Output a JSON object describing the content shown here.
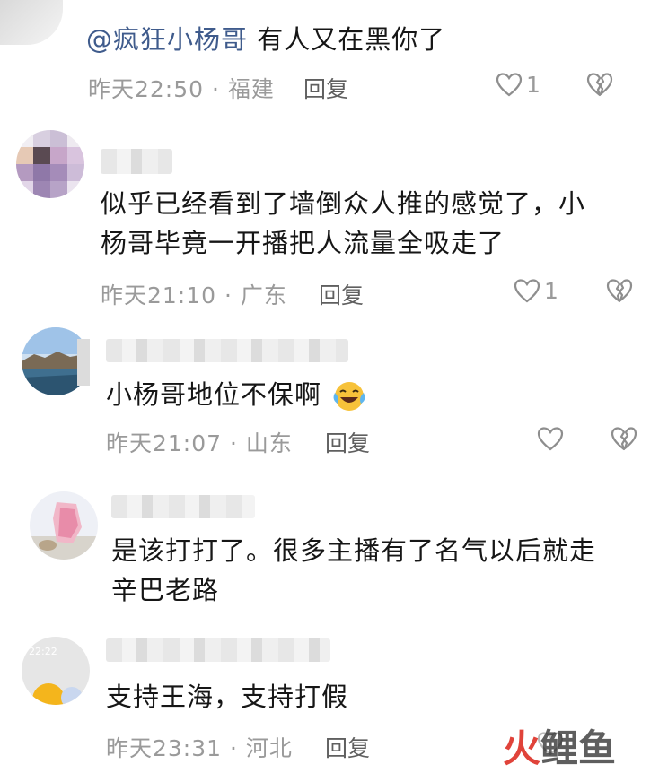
{
  "comments": [
    {
      "mention": "@疯狂小杨哥",
      "text": " 有人又在黑你了",
      "time": "昨天22:50",
      "sep": "·",
      "location": "福建",
      "reply": "回复",
      "likes": "1"
    },
    {
      "text_line1": "似乎已经看到了墙倒众人推的感觉了，小",
      "text_line2": "杨哥毕竟一开播把人流量全吸走了",
      "time": "昨天21:10",
      "sep": "·",
      "location": "广东",
      "reply": "回复",
      "likes": "1"
    },
    {
      "text": "小杨哥地位不保啊",
      "time": "昨天21:07",
      "sep": "·",
      "location": "山东",
      "reply": "回复"
    },
    {
      "text_line1": "是该打打了。很多主播有了名气以后就走",
      "text_line2": "辛巴老路"
    },
    {
      "avatar_time": "22:22",
      "text": "支持王海，支持打假",
      "time": "昨天23:31",
      "sep": "·",
      "location": "河北",
      "reply": "回复"
    }
  ],
  "watermark": {
    "char1": "火",
    "char2": "鲤",
    "char3": "鱼"
  },
  "colors": {
    "mention": "#3f5b8c",
    "meta": "#9a9a9a",
    "watermark_red": "#e0433a"
  },
  "icons": {
    "like": "heart-outline-icon",
    "dislike": "broken-heart-icon",
    "emoji": "laughing-tears-emoji-icon"
  }
}
